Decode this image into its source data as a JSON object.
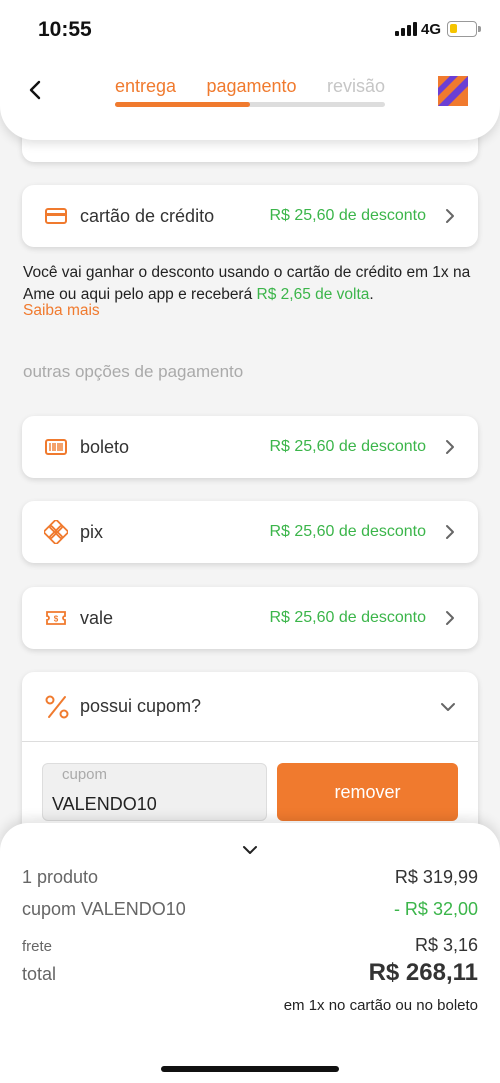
{
  "status_bar": {
    "time": "10:55",
    "network": "4G",
    "battery_level": 0.3
  },
  "header": {
    "back_icon": "chevron-left-icon",
    "steps": [
      {
        "label": "entrega",
        "active": true
      },
      {
        "label": "pagamento",
        "active": true
      },
      {
        "label": "revisão",
        "active": false
      }
    ],
    "progress": 0.5,
    "logo_colors": [
      "#f07a2e",
      "#6b3fd4"
    ]
  },
  "credit_card": {
    "name": "cartão de crédito",
    "discount": "R$ 25,60 de desconto",
    "icon": "credit-card-icon"
  },
  "info": {
    "text": "Você vai ganhar o desconto usando o cartão de crédito em 1x na Ame ou aqui pelo app e receberá ",
    "cashback": "R$ 2,65 de volta",
    "end": ".",
    "link": "Saiba mais"
  },
  "other_options": {
    "title": "outras opções de pagamento",
    "items": [
      {
        "name": "boleto",
        "discount": "R$ 25,60 de desconto",
        "icon": "barcode-icon"
      },
      {
        "name": "pix",
        "discount": "R$ 25,60 de desconto",
        "icon": "pix-icon"
      },
      {
        "name": "vale",
        "discount": "R$ 25,60 de desconto",
        "icon": "voucher-icon"
      }
    ]
  },
  "coupon": {
    "title": "possui cupom?",
    "input_label": "cupom",
    "input_value": "VALENDO10",
    "button": "remover"
  },
  "summary": {
    "product_label": "1 produto",
    "product_value": "R$ 319,99",
    "coupon_label": "cupom VALENDO10",
    "coupon_value": "- R$ 32,00",
    "shipping_label": "frete",
    "shipping_value": "R$ 3,16",
    "total_label": "total",
    "total_value": "R$ 268,11",
    "note": "em 1x no cartão ou no boleto"
  },
  "colors": {
    "accent": "#f07a2e",
    "green": "#3bb54a"
  }
}
